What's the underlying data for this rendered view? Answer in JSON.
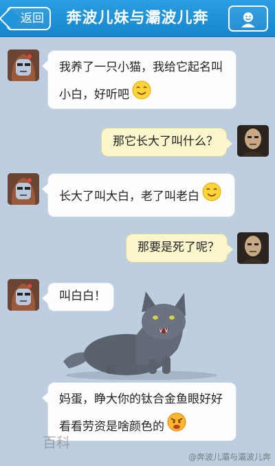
{
  "header": {
    "back_label": "返回",
    "title": "奔波儿妹与灞波儿奔"
  },
  "messages": [
    {
      "side": "left",
      "lines": [
        "我养了一只小猫，我给它起名叫",
        "小白，好听吧"
      ],
      "emoji": "smile-emoji"
    },
    {
      "side": "right",
      "lines": [
        "那它长大了叫什么？"
      ]
    },
    {
      "side": "left",
      "lines": [
        "长大了叫大白，老了叫老白"
      ],
      "emoji": "smile-emoji"
    },
    {
      "side": "right",
      "lines": [
        "那要是死了呢？"
      ]
    },
    {
      "side": "left",
      "lines": [
        "叫白白！"
      ]
    },
    {
      "side": "left",
      "lines": [
        "妈蛋，睁大你的钛合金鱼眼好好",
        "看看劳资是啥颜色的"
      ],
      "emoji": "angry-emoji"
    }
  ],
  "watermarks": {
    "baike": "百科",
    "weibo": "@奔波儿灞与灞波儿奔"
  },
  "colors": {
    "header": "#1686cf",
    "background": "#bccee0",
    "left_bubble": "#fcfdfe",
    "right_bubble": "#fbf6cc"
  }
}
